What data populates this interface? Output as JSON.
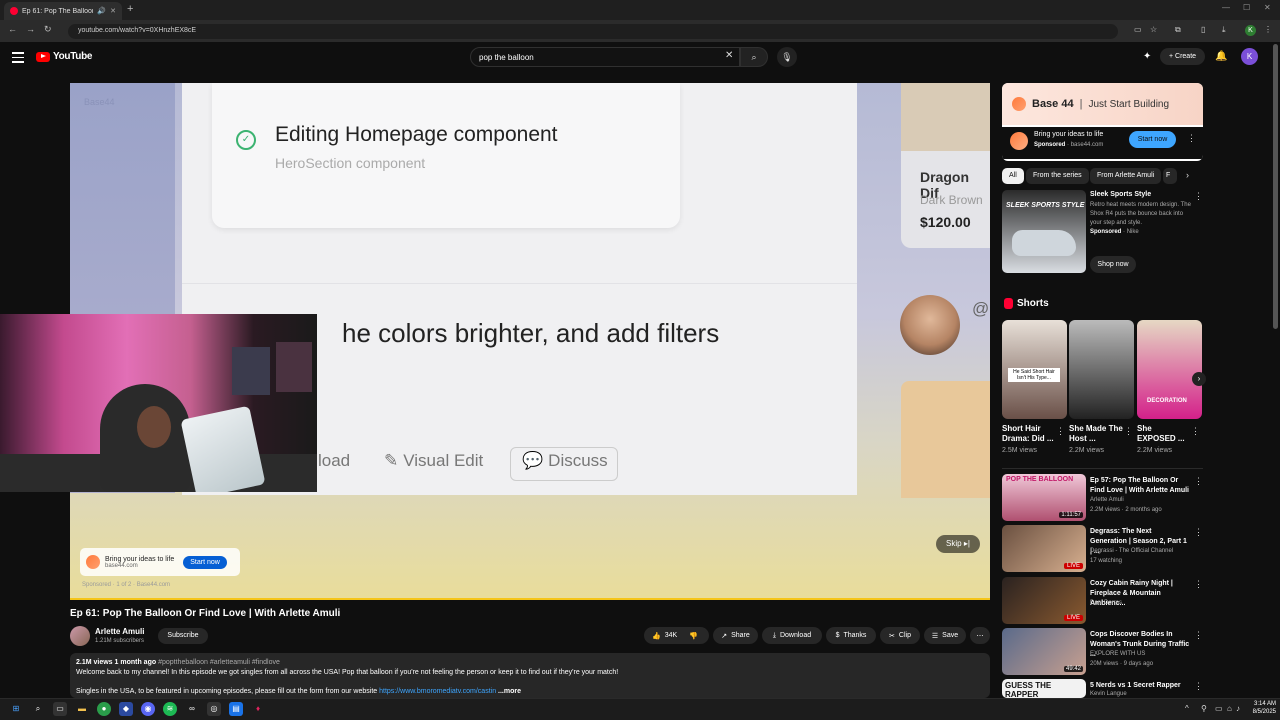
{
  "browser": {
    "tab_title": "Ep 61: Pop The Balloon Or F",
    "url": "youtube.com/watch?v=0XHnzhEX8cE",
    "profile_initial": "K"
  },
  "header": {
    "logo_text": "YouTube",
    "search_value": "pop the balloon",
    "create_label": "Create",
    "avatar_initial": "K"
  },
  "player": {
    "video_content": {
      "watermark": "Base44",
      "card_title": "Editing Homepage component",
      "card_subtitle": "HeroSection component",
      "prompt_text": "he colors brighter, and add filters",
      "btn_upload": "load",
      "btn_visual_edit": "Visual Edit",
      "btn_discuss": "Discuss",
      "product_name": "Dragon Dif",
      "product_color": "Dark Brown",
      "product_price": "$120.00",
      "at_symbol": "@"
    },
    "ad": {
      "text": "Bring your ideas to life",
      "domain": "base44.com",
      "button": "Start now",
      "sponsor_line": "Sponsored · 1 of 2 · Base44.com"
    },
    "skip_label": "Skip"
  },
  "video": {
    "title": "Ep 61: Pop The Balloon Or Find Love | With Arlette Amuli",
    "channel": "Arlette Amuli",
    "subscribers": "1.21M subscribers",
    "subscribe_label": "Subscribe",
    "actions": {
      "likes": "34K",
      "share": "Share",
      "download": "Download",
      "thanks": "Thanks",
      "clip": "Clip",
      "save": "Save"
    },
    "description": {
      "stats": "2.1M views  1 month ago",
      "hashtags": "#popttheballoon #arletteamuli #findlove",
      "line1": "Welcome back to my channel! In this episode we got singles from all across the USA! Pop that balloon if you're not feeling the person or keep it to find out if they're your match!",
      "line2": "Singles in the USA, to be featured in upcoming episodes, please fill out the form from our website",
      "link": "https://www.bmoromediatv.com/castin",
      "more": "...more"
    }
  },
  "sidebar": {
    "ad": {
      "brand": "Base 44",
      "separator": "|",
      "tagline": "Just Start Building",
      "title": "Bring your ideas to life",
      "sponsored": "Sponsored",
      "domain": "base44.com",
      "button": "Start now"
    },
    "chips": [
      "All",
      "From the series",
      "From Arlette Amuli",
      "F"
    ],
    "sponsored_item": {
      "thumb_label": "SLEEK SPORTS STYLE",
      "title": "Sleek Sports Style",
      "desc": "Retro heat meets modern design. The Shox R4 puts the bounce back into your step and style.",
      "sponsored": "Sponsored",
      "brand": "Nike",
      "button": "Shop now"
    },
    "shorts_heading": "Shorts",
    "shorts": [
      {
        "title": "Short Hair Drama: Did ...",
        "views": "2.5M views",
        "overlay": "He Said Short Hair Isn't His Type..."
      },
      {
        "title": "She Made The Host ...",
        "views": "2.2M views",
        "overlay": ""
      },
      {
        "title": "She EXPOSED ...",
        "views": "2.2M views",
        "overlay": "DECORATION"
      }
    ],
    "related": [
      {
        "title": "Ep 57: Pop The Balloon Or Find Love | With Arlette Amuli",
        "channel": "Arlette Amuli",
        "meta": "2.2M views · 2 months ago",
        "badge": "1:11:57",
        "thumb_text": "POP THE BALLOON"
      },
      {
        "title": "Degrass: The Next Generation | Season 2, Part 1 | ...",
        "channel": "Degrassi - The Official Channel",
        "meta": "17 watching",
        "badge": "LIVE",
        "thumb_text": ""
      },
      {
        "title": "Cozy Cabin Rainy Night | Fireplace & Mountain Ambienc...",
        "channel": "Dani Derres",
        "meta": "",
        "badge": "LIVE",
        "thumb_text": ""
      },
      {
        "title": "Cops Discover Bodies In Woman's Trunk During Traffic ...",
        "channel": "EXPLORE WITH US",
        "meta": "20M views · 9 days ago",
        "badge": "49:42",
        "thumb_text": ""
      },
      {
        "title": "5 Nerds vs 1 Secret Rapper",
        "channel": "Kevin Langue",
        "meta": "",
        "badge": "",
        "thumb_text": "GUESS THE RAPPER"
      }
    ]
  },
  "taskbar": {
    "time": "3:14 AM",
    "date": "8/5/2025"
  },
  "colors": {
    "brand_red": "#ff0000",
    "accent_blue": "#3ea6ff",
    "progress_yellow": "#f5c518"
  }
}
